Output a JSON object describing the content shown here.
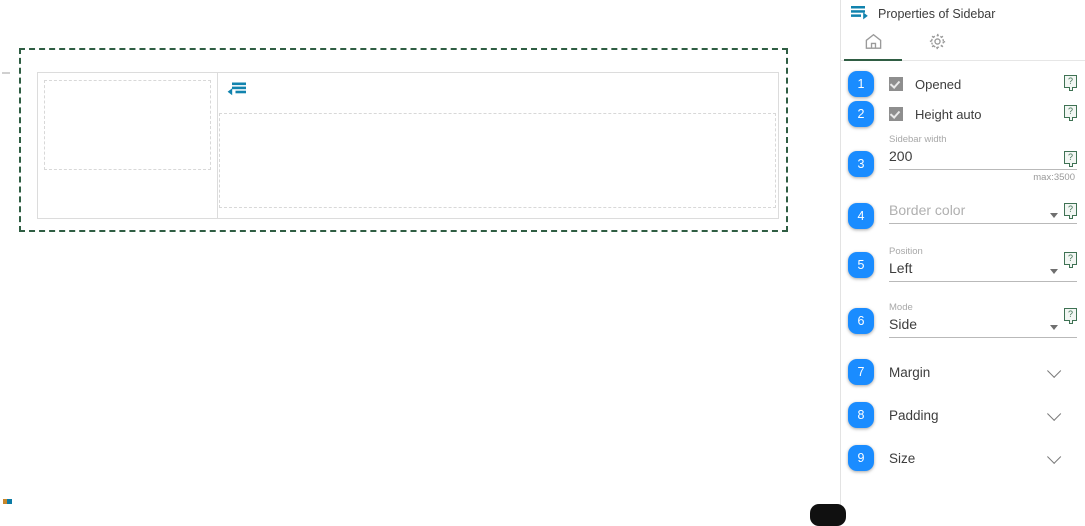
{
  "canvas": {
    "component_name": "sidebar-component-preview",
    "toggle_icon": "format-indent-decrease-icon",
    "frame_style": "dashed-selection-frame"
  },
  "panel": {
    "header": {
      "menu_icon": "sidebar-list-icon",
      "title": "Properties of Sidebar"
    },
    "tabs": [
      {
        "name": "tab-home",
        "icon": "home-icon",
        "active": true
      },
      {
        "name": "tab-settings",
        "icon": "gear-icon",
        "active": false
      }
    ],
    "help_glyph": "?",
    "rows": [
      {
        "badge": "1",
        "type": "checkbox",
        "label": "Opened",
        "checked": true,
        "name": "opened-checkbox"
      },
      {
        "badge": "2",
        "type": "checkbox",
        "label": "Height auto",
        "checked": true,
        "name": "height-auto-checkbox"
      },
      {
        "badge": "3",
        "type": "text",
        "label": "Sidebar width",
        "value": "200",
        "hint": "max:3500",
        "name": "sidebar-width-input"
      },
      {
        "badge": "4",
        "type": "select",
        "label": "",
        "value": "Border color",
        "is_placeholder": true,
        "name": "border-color-select"
      },
      {
        "badge": "5",
        "type": "select",
        "label": "Position",
        "value": "Left",
        "is_placeholder": false,
        "name": "position-select"
      },
      {
        "badge": "6",
        "type": "select",
        "label": "Mode",
        "value": "Side",
        "is_placeholder": false,
        "name": "mode-select"
      },
      {
        "badge": "7",
        "type": "expander",
        "label": "Margin",
        "name": "margin-section"
      },
      {
        "badge": "8",
        "type": "expander",
        "label": "Padding",
        "name": "padding-section"
      },
      {
        "badge": "9",
        "type": "expander",
        "label": "Size",
        "name": "size-section"
      }
    ]
  },
  "colors": {
    "badge_blue": "#1a8cff",
    "accent_green": "#2f5d43",
    "icon_teal": "#1183ae",
    "help_green": "#3f7254"
  }
}
